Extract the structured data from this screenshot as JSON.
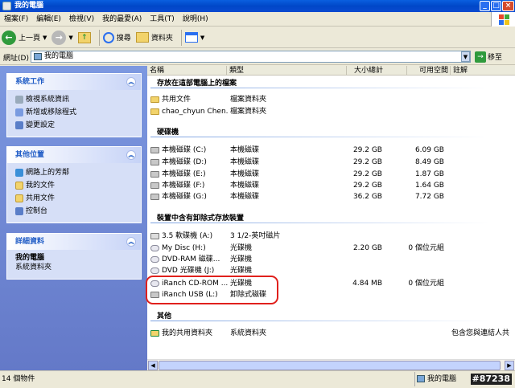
{
  "window": {
    "title": "我的電腦"
  },
  "menu": [
    "檔案(F)",
    "編輯(E)",
    "檢視(V)",
    "我的最愛(A)",
    "工具(T)",
    "說明(H)"
  ],
  "toolbar": {
    "back": "上一頁",
    "search": "搜尋",
    "folders": "資料夾"
  },
  "address": {
    "label": "網址(D)",
    "value": "我的電腦",
    "go": "移至"
  },
  "taskpane": {
    "system": {
      "title": "系統工作",
      "items": [
        "檢視系統資訊",
        "新增或移除程式",
        "變更設定"
      ]
    },
    "other": {
      "title": "其他位置",
      "items": [
        "網路上的芳鄰",
        "我的文件",
        "共用文件",
        "控制台"
      ]
    },
    "details": {
      "title": "詳細資料",
      "name": "我的電腦",
      "desc": "系統資料夾"
    }
  },
  "columns": {
    "name": "名稱",
    "type": "類型",
    "total": "大小總計",
    "free": "可用空間",
    "comment": "註解"
  },
  "groups": {
    "stored": "存放在這部電腦上的檔案",
    "hdd": "硬碟機",
    "removable": "裝置中含有卸除式存放裝置",
    "other": "其他"
  },
  "rows": {
    "shared": {
      "name": "共用文件",
      "type": "檔案資料夾"
    },
    "chao": {
      "name": "chao_chyun Chen...",
      "type": "檔案資料夾"
    },
    "c": {
      "name": "本機磁碟 (C:)",
      "type": "本機磁碟",
      "total": "29.2 GB",
      "free": "6.09 GB"
    },
    "d": {
      "name": "本機磁碟 (D:)",
      "type": "本機磁碟",
      "total": "29.2 GB",
      "free": "8.49 GB"
    },
    "e": {
      "name": "本機磁碟 (E:)",
      "type": "本機磁碟",
      "total": "29.2 GB",
      "free": "1.87 GB"
    },
    "f": {
      "name": "本機磁碟 (F:)",
      "type": "本機磁碟",
      "total": "29.2 GB",
      "free": "1.64 GB"
    },
    "g": {
      "name": "本機磁碟 (G:)",
      "type": "本機磁碟",
      "total": "36.2 GB",
      "free": "7.72 GB"
    },
    "a": {
      "name": "3.5 軟碟機 (A:)",
      "type": "3 1/2-英吋磁片"
    },
    "h": {
      "name": "My Disc (H:)",
      "type": "光碟機",
      "total": "2.20 GB",
      "free": "0 個位元組"
    },
    "i": {
      "name": "DVD-RAM 磁碟...",
      "type": "光碟機"
    },
    "j": {
      "name": "DVD 光碟機 (J:)",
      "type": "光碟機"
    },
    "k": {
      "name": "iRanch CD-ROM ...",
      "type": "光碟機",
      "total": "4.84 MB",
      "free": "0 個位元組"
    },
    "l": {
      "name": "iRanch USB (L:)",
      "type": "卸除式磁碟"
    },
    "net": {
      "name": "我的共用資料夾",
      "type": "系統資料夾",
      "comment": "包含您與連結人共"
    }
  },
  "status": {
    "count": "14 個物件",
    "location": "我的電腦"
  },
  "watermark": "#87238"
}
